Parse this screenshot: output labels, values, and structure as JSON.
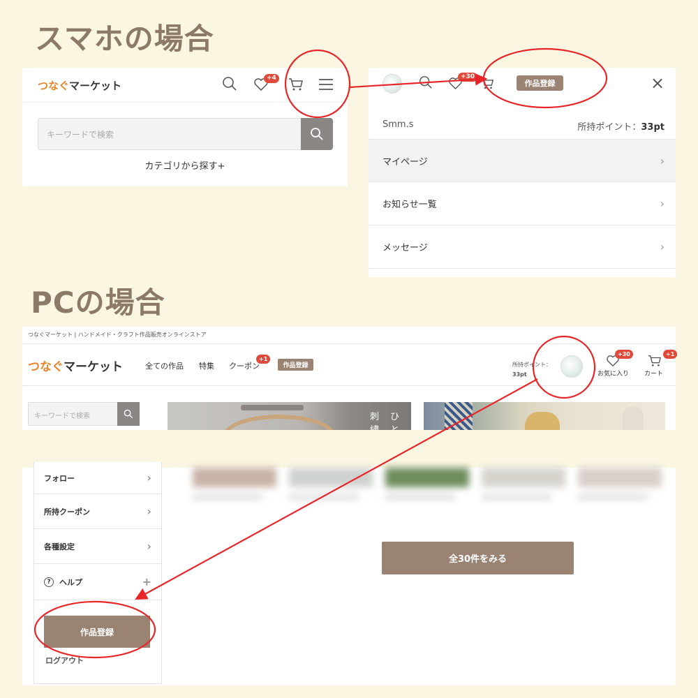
{
  "titles": {
    "smartphone": "スマホの場合",
    "pc": "PCの場合"
  },
  "sp_header": {
    "logo_part1": "つなぐ",
    "logo_part2": "マーケット",
    "favorites_badge": "+4",
    "search_placeholder": "キーワードで検索",
    "category_link": "カテゴリから探す+"
  },
  "sp_menu": {
    "favorites_badge": "+30",
    "register_button": "作品登録",
    "close_icon": "×",
    "user_name": "Smm.s",
    "points_label": "所持ポイント：",
    "points_value": "33pt",
    "items": [
      {
        "label": "マイページ"
      },
      {
        "label": "お知らせ一覧"
      },
      {
        "label": "メッセージ"
      }
    ]
  },
  "pc": {
    "tagline": "つなぐマーケット | ハンドメイド・クラフト作品販売オンラインストア",
    "logo_part1": "つなぐ",
    "logo_part2": "マーケット",
    "nav_all": "全ての作品",
    "nav_feature": "特集",
    "nav_coupon": "クーポン",
    "coupon_badge": "+1",
    "nav_register": "作品登録",
    "points_label": "所持ポイント：",
    "points_value": "33pt",
    "favorites_badge": "+30",
    "favorites_label": "お気に入り",
    "cart_badge": "+1",
    "cart_label": "カート",
    "search_placeholder": "キーワードで検索",
    "banner_text": "刺 ひ 繍 と",
    "sidebar": {
      "items": [
        {
          "label": "フォロー",
          "icon": "›"
        },
        {
          "label": "所持クーポン",
          "icon": "›"
        },
        {
          "label": "各種設定",
          "icon": "›"
        },
        {
          "label": "ヘルプ",
          "icon": "+"
        }
      ],
      "register_button": "作品登録",
      "logout": "ログアウト"
    },
    "see_all_button": "全30件をみる"
  },
  "colors": {
    "background": "#faf6e2",
    "accent_brown": "#9a8372",
    "logo_orange": "#e8852a",
    "badge_red": "#e04a3a",
    "annotation_red": "#e8262a"
  }
}
